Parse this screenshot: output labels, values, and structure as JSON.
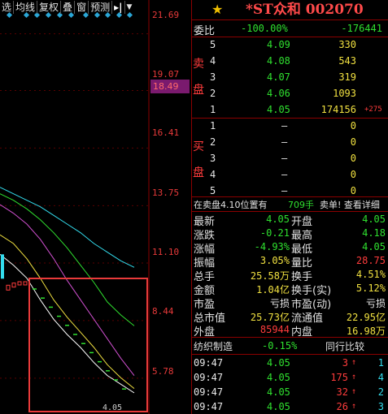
{
  "toolbar": {
    "buttons": [
      "选",
      "均线",
      "复权",
      "叠",
      "窗",
      "预测"
    ],
    "more_arrow": "▸|",
    "dropdown": "▼"
  },
  "price_axis": {
    "labels": [
      "21.69",
      "19.07",
      "16.41",
      "13.75",
      "11.10",
      "8.44",
      "5.78"
    ],
    "current_price_tag": "18.49"
  },
  "chart_data": {
    "type": "line",
    "note_label": "4.05",
    "series": [
      {
        "color": "#ffffff",
        "values": [
          11.5,
          11.0,
          10.4,
          9.4,
          8.5,
          7.8,
          7.2,
          6.5,
          5.9,
          5.5,
          5.1
        ]
      },
      {
        "color": "#f0e040",
        "values": [
          12.4,
          12.0,
          11.3,
          10.4,
          9.4,
          8.6,
          7.9,
          7.2,
          6.4,
          5.8,
          5.3
        ]
      },
      {
        "color": "#d050d0",
        "values": [
          13.8,
          13.4,
          12.9,
          12.2,
          11.3,
          10.3,
          9.4,
          8.5,
          7.6,
          6.7,
          5.9
        ]
      },
      {
        "color": "#2fe02f",
        "values": [
          14.3,
          14.0,
          13.6,
          13.1,
          12.5,
          11.8,
          11.0,
          10.2,
          9.3,
          8.7,
          8.2
        ]
      },
      {
        "color": "#33ddee",
        "values": [
          14.6,
          14.3,
          14.0,
          13.7,
          13.3,
          12.9,
          12.5,
          12.0,
          11.6,
          11.2,
          10.9
        ]
      }
    ],
    "ylim": [
      4.5,
      22.5
    ]
  },
  "quote": {
    "title": "*ST众和 002070",
    "weibi_label": "委比",
    "weibi_pct": "-100.00%",
    "weibi_diff": "-176441",
    "sell_label": "卖盘",
    "buy_label": "买盘",
    "sell": [
      {
        "level": "5",
        "price": "4.09",
        "vol": "330",
        "extra": ""
      },
      {
        "level": "4",
        "price": "4.08",
        "vol": "543",
        "extra": ""
      },
      {
        "level": "3",
        "price": "4.07",
        "vol": "319",
        "extra": ""
      },
      {
        "level": "2",
        "price": "4.06",
        "vol": "1093",
        "extra": ""
      },
      {
        "level": "1",
        "price": "4.05",
        "vol": "174156",
        "extra": "+275"
      }
    ],
    "buy": [
      {
        "level": "1",
        "price": "–",
        "vol": "0"
      },
      {
        "level": "2",
        "price": "–",
        "vol": "0"
      },
      {
        "level": "3",
        "price": "–",
        "vol": "0"
      },
      {
        "level": "4",
        "price": "–",
        "vol": "0"
      },
      {
        "level": "5",
        "price": "–",
        "vol": "0"
      }
    ],
    "notice": {
      "text": "在卖盘4.10位置有",
      "vol": "709手",
      "link": "卖单! 查看详细"
    },
    "stats": [
      {
        "l1": "最新",
        "v1": "4.05",
        "c1": "green",
        "l2": "开盘",
        "v2": "4.05",
        "c2": "green"
      },
      {
        "l1": "涨跌",
        "v1": "-0.21",
        "c1": "green",
        "l2": "最高",
        "v2": "4.18",
        "c2": "green"
      },
      {
        "l1": "涨幅",
        "v1": "-4.93%",
        "c1": "green",
        "l2": "最低",
        "v2": "4.05",
        "c2": "green"
      },
      {
        "l1": "振幅",
        "v1": "3.05%",
        "c1": "yellow",
        "l2": "量比",
        "v2": "28.75",
        "c2": "red"
      },
      {
        "l1": "总手",
        "v1": "25.58万",
        "c1": "yellow",
        "l2": "换手",
        "v2": "4.51%",
        "c2": "yellow"
      },
      {
        "l1": "金额",
        "v1": "1.04亿",
        "c1": "yellow",
        "l2": "换手(实)",
        "v2": "5.12%",
        "c2": "yellow"
      },
      {
        "l1": "市盈",
        "v1": "亏损",
        "c1": "white",
        "l2": "市盈(动)",
        "v2": "亏损",
        "c2": "white"
      },
      {
        "l1": "总市值",
        "v1": "25.73亿",
        "c1": "yellow",
        "l2": "流通值",
        "v2": "22.95亿",
        "c2": "yellow"
      },
      {
        "l1": "外盘",
        "v1": "85944",
        "c1": "red",
        "l2": "内盘",
        "v2": "16.98万",
        "c2": "yellow"
      }
    ],
    "sector": {
      "name": "纺织制造",
      "pct": "-0.15%",
      "compare": "同行比较"
    },
    "ticks": [
      {
        "time": "09:47",
        "price": "4.05",
        "vol": "3",
        "arrow": "↑",
        "n": "1"
      },
      {
        "time": "09:47",
        "price": "4.05",
        "vol": "175",
        "arrow": "↑",
        "n": "4"
      },
      {
        "time": "09:47",
        "price": "4.05",
        "vol": "32",
        "arrow": "↑",
        "n": "2"
      },
      {
        "time": "09:47",
        "price": "4.05",
        "vol": "26",
        "arrow": "↑",
        "n": "3"
      }
    ]
  }
}
